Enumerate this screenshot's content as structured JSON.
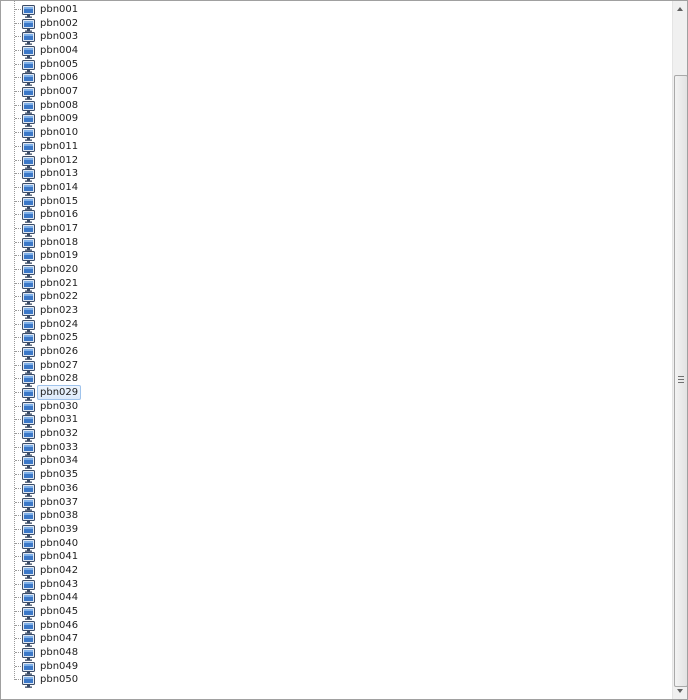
{
  "tree": {
    "selected_index": 28,
    "item_icon": "monitor-icon",
    "items": [
      "pbn001",
      "pbn002",
      "pbn003",
      "pbn004",
      "pbn005",
      "pbn006",
      "pbn007",
      "pbn008",
      "pbn009",
      "pbn010",
      "pbn011",
      "pbn012",
      "pbn013",
      "pbn014",
      "pbn015",
      "pbn016",
      "pbn017",
      "pbn018",
      "pbn019",
      "pbn020",
      "pbn021",
      "pbn022",
      "pbn023",
      "pbn024",
      "pbn025",
      "pbn026",
      "pbn027",
      "pbn028",
      "pbn029",
      "pbn030",
      "pbn031",
      "pbn032",
      "pbn033",
      "pbn034",
      "pbn035",
      "pbn036",
      "pbn037",
      "pbn038",
      "pbn039",
      "pbn040",
      "pbn041",
      "pbn042",
      "pbn043",
      "pbn044",
      "pbn045",
      "pbn046",
      "pbn047",
      "pbn048",
      "pbn049",
      "pbn050"
    ]
  },
  "scrollbar": {
    "position_fraction": 1.0
  },
  "colors": {
    "selection_border": "#9fc3ec",
    "selection_fill": "#dceafb",
    "monitor_screen": "#3b78c8",
    "text": "#1e1e1e"
  }
}
